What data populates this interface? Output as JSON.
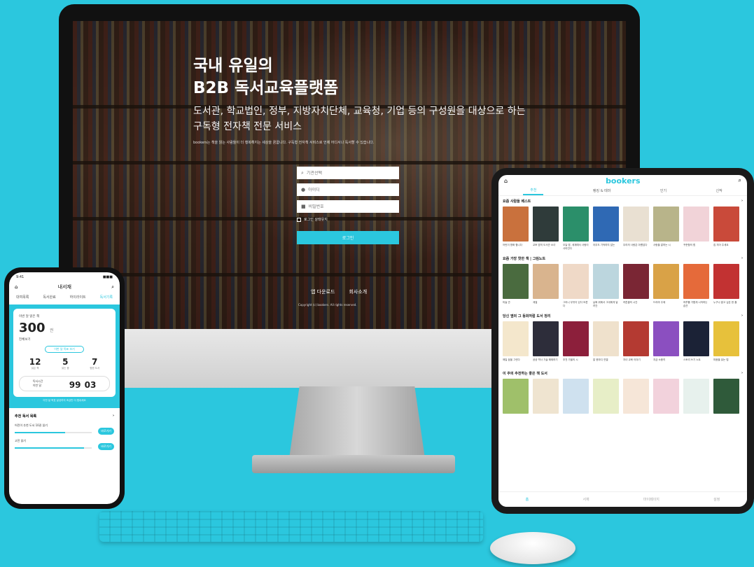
{
  "desktop": {
    "hero": {
      "title_line1": "국내 유일의",
      "title_line2": "B2B 독서교육플랫폼",
      "subtitle_line1": "도서관, 학교법인, 정부, 지방자치단체, 교육청, 기업 등의 구성원을 대상으로 하는",
      "subtitle_line2": "구독형 전자책 전문 서비스",
      "note": "bookers는 책을 읽는 사람들이 더 행복해지는 세상을 꿈꿉니다. 구독형 전자책 서비스로 언제 어디서나 독서할 수 있습니다."
    },
    "login": {
      "institution_placeholder": "기관선택",
      "id_placeholder": "아이디",
      "password_placeholder": "비밀번호",
      "remember_label": "로그인 상태유지",
      "submit_label": "로그인"
    },
    "footer": {
      "links": [
        "앱 다운로드",
        "회사소개"
      ],
      "copyright": "Copyright (c) bookers. All rights reserved."
    }
  },
  "tablet": {
    "logo": "bookers",
    "tabs": [
      "추천",
      "랭킹 & 테마",
      "인기",
      "신작"
    ],
    "sections": [
      {
        "title": "요즘 사람들 베스트",
        "captions": [
          "어린이 명화 합니다",
          "교토 밤의 도서관 소녀",
          "오늘 밤, 세계에서 사랑이 사라진다",
          "아무도 기억하지 않는",
          "우리의 사랑은 아름답다",
          "사랑을 말하는 시",
          "꾸준함의 힘",
          "집 지어 주세요"
        ]
      },
      {
        "title": "요즘 가장 핫한 책 | 그림노트",
        "captions": [
          "미술 관",
          "계절",
          "그러니 무엇이 있다 모른다",
          "날짜 위에서 그대에게 달려간",
          "커튼콜의 시간",
          "드라마 주제",
          "하루를 가볍게 시작하는 습관",
          "누구나 알고 싶은 한 줄"
        ]
      },
      {
        "title": "당신 옆의 그 동화처럼 도서 정리",
        "captions": [
          "매일 꿈을 그린다",
          "공공 역사 기술 해제하기",
          "추천 가을의 시",
          "말 한마디 연결",
          "자녀 교육 이야기",
          "지금 소중히",
          "스토리 쓰기 노트",
          "마음을 읽는 법"
        ]
      },
      {
        "title": "이 주의 추천하는 좋은 책 도서",
        "captions": [
          "",
          "",
          "",
          "",
          "",
          "",
          "",
          ""
        ]
      }
    ],
    "bottom_nav": [
      "홈",
      "서재",
      "마이페이지",
      "설정"
    ]
  },
  "phone": {
    "status_time": "9:41",
    "status_signal": "■■■",
    "header_title": "내서재",
    "tabs": [
      "대여목록",
      "독서완료",
      "하이라이트",
      "독서기록"
    ],
    "reading_label": "이번 달 읽은 책",
    "reading_count": "300",
    "reading_unit": "권",
    "reading_sub": "전체보기",
    "pill_label": "이번 달 목표 보기",
    "stats": [
      {
        "value": "12",
        "label": "읽은 책"
      },
      {
        "value": "5",
        "label": "읽는 중"
      },
      {
        "value": "7",
        "label": "찜한 도서"
      }
    ],
    "timer_label_1": "독서시간",
    "timer_label_2": "이번 달",
    "timer_hours": "99",
    "timer_minutes": "03",
    "timer_note": "이번 달 목표 달성까지 조금만 더 힘내세요",
    "list_title": "추천 독서 목록",
    "items": [
      {
        "label": "어린이 추천 도서 10권 읽기",
        "progress": 0.65,
        "button": "바로가기"
      },
      {
        "label": "고전 읽기",
        "progress": 0.9,
        "button": "바로가기"
      }
    ]
  },
  "colors": {
    "brand": "#2bc7de",
    "background": "#2bc7de"
  }
}
